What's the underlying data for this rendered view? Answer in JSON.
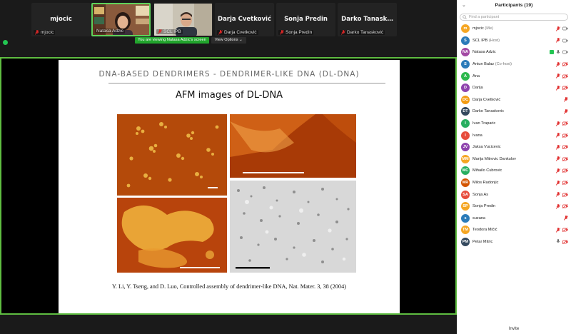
{
  "participants_strip": [
    {
      "display": "mjocic",
      "label": "mjocic",
      "video": false,
      "muted": true
    },
    {
      "display": "",
      "label": "Natasa Adzic",
      "video": true,
      "active": true,
      "muted": false
    },
    {
      "display": "",
      "label": "SCL IPB",
      "video": true,
      "muted": true
    },
    {
      "display": "Darja Cvetković",
      "label": "Darja Cvetković",
      "video": false,
      "muted": true
    },
    {
      "display": "Sonja Predin",
      "label": "Sonja Predin",
      "video": false,
      "muted": true
    },
    {
      "display": "Darko Tanask…",
      "label": "Darko Tanasković",
      "video": false,
      "muted": true
    }
  ],
  "share_notice": {
    "viewing": "You are viewing Natasa Adzic's screen",
    "view_options": "View Options"
  },
  "slide": {
    "header": "DNA-BASED DENDRIMERS    -    DENDRIMER-LIKE DNA (DL-DNA)",
    "title": "AFM images of DL-DNA",
    "reference": "Y. Li, Y. Tseng, and D. Luo, Controlled assembly of dendrimer-like DNA, Nat. Mater. 3, 38 (2004)"
  },
  "panel": {
    "title": "Participants (19)",
    "search_placeholder": "Find a participant",
    "invite": "Invite",
    "participants": [
      {
        "initials": "m",
        "name": "mjocic",
        "role": "(Me)",
        "color": "#f5a623",
        "muted": true,
        "video_off": false
      },
      {
        "initials": "S",
        "name": "SCL IPB",
        "role": "(Host)",
        "color": "#2b7bb9",
        "logo": true,
        "muted": true,
        "video_off": false
      },
      {
        "initials": "NA",
        "name": "Natasa Adzic",
        "role": "",
        "color": "#a349a4",
        "muted": false,
        "video_off": false,
        "speaking": true
      },
      {
        "initials": "S",
        "name": "Antun Balaz",
        "role": "(Co-host)",
        "color": "#2b7bb9",
        "logo": true,
        "muted": true,
        "video_off": true
      },
      {
        "initials": "A",
        "name": "Ana",
        "role": "",
        "color": "#2db84d",
        "muted": true,
        "video_off": true
      },
      {
        "initials": "D",
        "name": "Darija",
        "role": "",
        "color": "#8e44ad",
        "muted": true,
        "video_off": true
      },
      {
        "initials": "DC",
        "name": "Darja Cvetković",
        "role": "",
        "color": "#f39c12",
        "muted": true,
        "video_off": false
      },
      {
        "initials": "DT",
        "name": "Darko Tanaskovic",
        "role": "",
        "color": "#34495e",
        "muted": true,
        "video_off": false
      },
      {
        "initials": "I",
        "name": "Ivan Traparic",
        "role": "",
        "color": "#27ae60",
        "muted": true,
        "video_off": true
      },
      {
        "initials": "I",
        "name": "Ivana",
        "role": "",
        "color": "#e74c3c",
        "muted": true,
        "video_off": true
      },
      {
        "initials": "JV",
        "name": "Jaksa Vucicevic",
        "role": "",
        "color": "#8e44ad",
        "muted": true,
        "video_off": true
      },
      {
        "initials": "MM",
        "name": "Marija Mitrovic Dankulov",
        "role": "",
        "color": "#f5a623",
        "muted": true,
        "video_off": true
      },
      {
        "initials": "MC",
        "name": "Mihailo Cubrovic",
        "role": "",
        "color": "#27ae60",
        "muted": true,
        "video_off": true
      },
      {
        "initials": "MR",
        "name": "Milos Radonjic",
        "role": "",
        "color": "#d35400",
        "muted": true,
        "video_off": true
      },
      {
        "initials": "SA",
        "name": "Sonja As",
        "role": "",
        "color": "#e74c3c",
        "muted": true,
        "video_off": true
      },
      {
        "initials": "SP",
        "name": "Sonja Predin",
        "role": "",
        "color": "#f5a623",
        "muted": true,
        "video_off": true
      },
      {
        "initials": "s",
        "name": "suzana",
        "role": "",
        "color": "#2b7bb9",
        "muted": true,
        "video_off": false
      },
      {
        "initials": "TM",
        "name": "Teodora Mičić",
        "role": "",
        "color": "#f5a623",
        "muted": true,
        "video_off": true
      },
      {
        "initials": "PM",
        "name": "Petar Mitric",
        "role": "",
        "color": "#34495e",
        "muted": false,
        "video_off": true
      }
    ]
  },
  "colors": {
    "accent_green": "#5fbd41",
    "muted_red": "#e02828"
  }
}
